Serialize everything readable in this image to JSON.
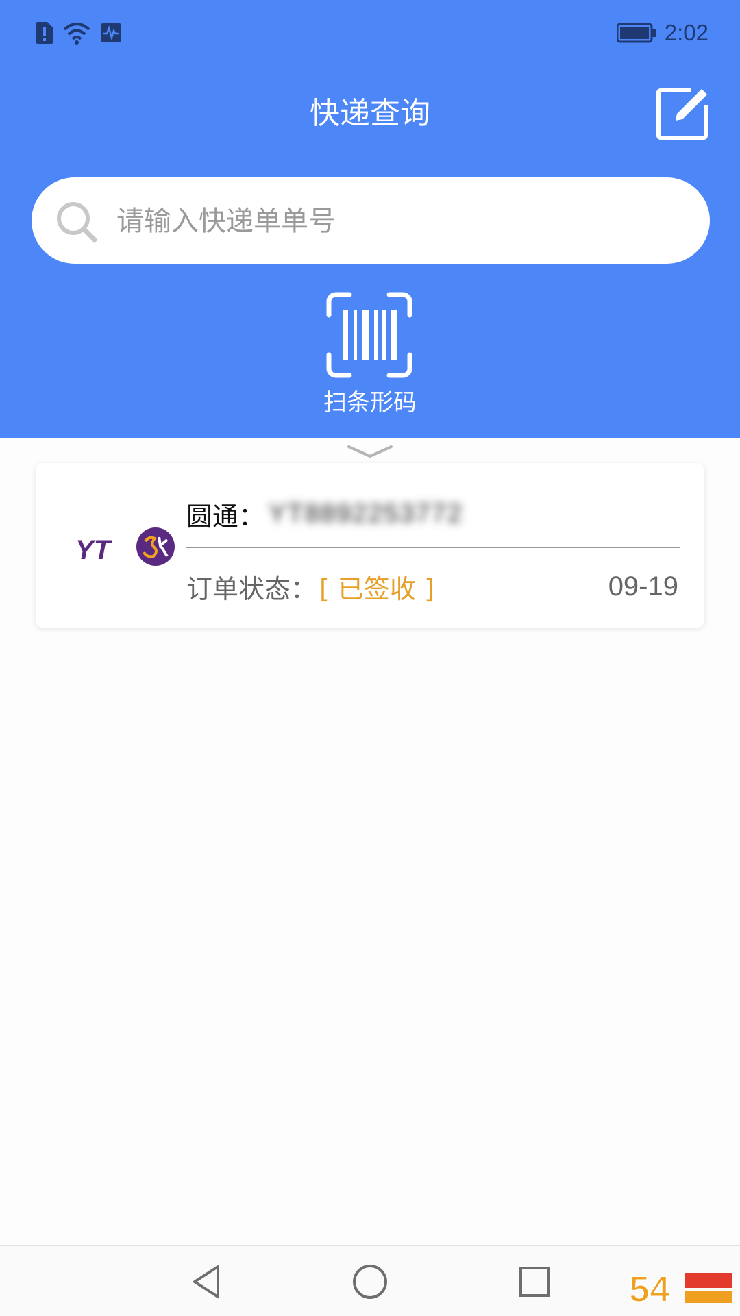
{
  "status_bar": {
    "time": "2:02"
  },
  "header": {
    "title": "快递查询"
  },
  "search": {
    "placeholder": "请输入快递单单号"
  },
  "scan": {
    "label": "扫条形码"
  },
  "orders": [
    {
      "carrier": "圆通",
      "separator": "：",
      "tracking_number": "YT8892253772",
      "status_label": "订单状态：",
      "status_value": "[ 已签收 ]",
      "date": "09-19",
      "logo_text": "YT"
    }
  ],
  "watermark": {
    "text": "54"
  },
  "colors": {
    "primary": "#4d86f7",
    "status_signed": "#e6a029",
    "logo": "#5a2a82"
  },
  "icons": {
    "compose": "compose-icon",
    "search": "search-icon",
    "scan": "barcode-scan-icon",
    "chevron": "chevron-down-icon",
    "back": "back-triangle-icon",
    "home": "home-circle-icon",
    "recents": "recents-square-icon"
  }
}
